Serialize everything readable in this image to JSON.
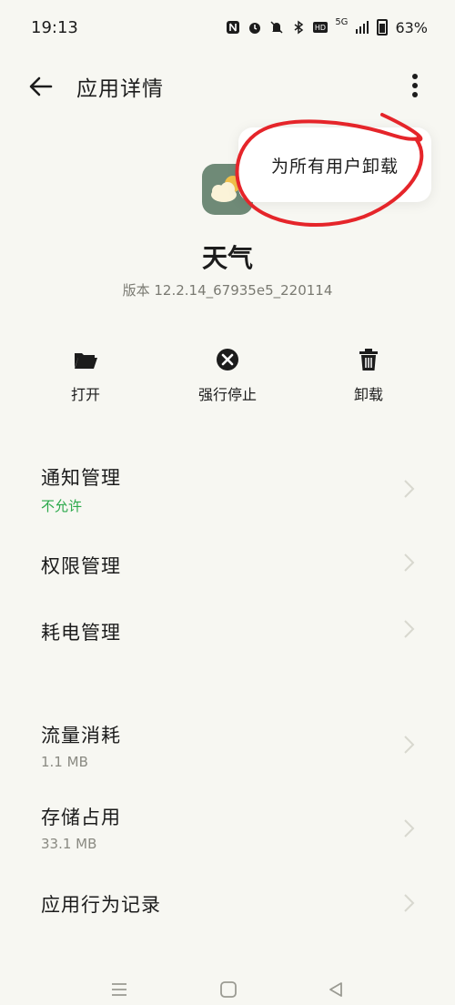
{
  "status_bar": {
    "time": "19:13",
    "network": "5G",
    "battery": "63%",
    "icons": [
      "nfc-icon",
      "alarm-icon",
      "mute-icon",
      "bluetooth-icon",
      "hd-icon",
      "signal-icon",
      "battery-icon"
    ]
  },
  "header": {
    "title": "应用详情",
    "back_icon": "back-arrow-icon",
    "more_icon": "more-vert-icon"
  },
  "popup_menu": {
    "items": [
      "为所有用户卸载"
    ]
  },
  "app": {
    "name": "天气",
    "version": "版本 12.2.14_67935e5_220114",
    "icon": "weather-icon"
  },
  "actions": [
    {
      "label": "打开",
      "icon": "folder-open-icon"
    },
    {
      "label": "强行停止",
      "icon": "force-stop-icon"
    },
    {
      "label": "卸载",
      "icon": "trash-icon"
    }
  ],
  "list": [
    {
      "title": "通知管理",
      "subtitle": "不允许"
    },
    {
      "title": "权限管理",
      "subtitle": ""
    },
    {
      "title": "耗电管理",
      "subtitle": ""
    },
    {
      "title": "流量消耗",
      "subtitle": "1.1 MB"
    },
    {
      "title": "存储占用",
      "subtitle": "33.1 MB"
    },
    {
      "title": "应用行为记录",
      "subtitle": ""
    }
  ],
  "colors": {
    "background": "#f7f7f2",
    "accent_green": "#2aa84a",
    "annotation_red": "#e5252a",
    "app_icon_bg": "#6f8a77"
  },
  "navbar": {
    "icons": [
      "menu-icon",
      "home-icon",
      "back-triangle-icon"
    ]
  }
}
